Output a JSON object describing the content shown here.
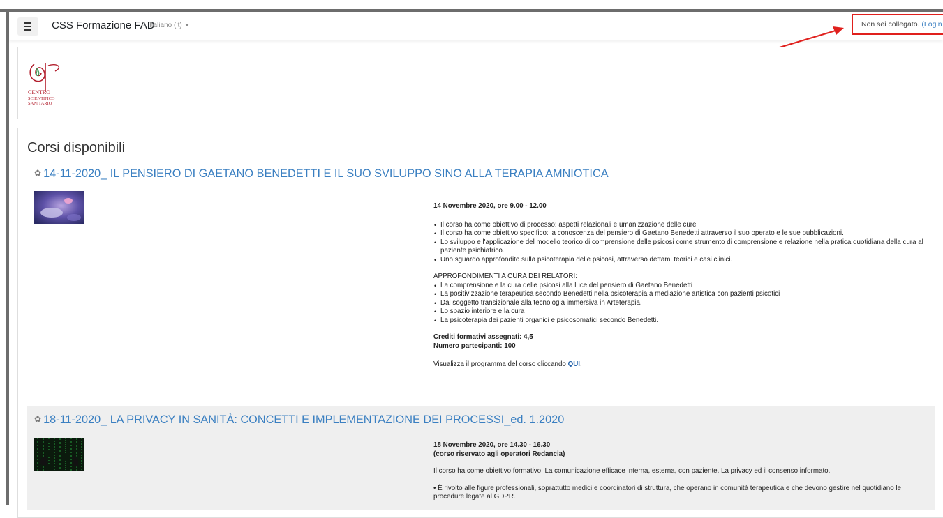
{
  "navbar": {
    "site_name": "CSS Formazione FAD",
    "language": "Italiano (it)",
    "login_text": "Non sei collegato.",
    "login_link": "(Login"
  },
  "logo": {
    "lines": [
      "CENTRO",
      "SCIENTIFICO",
      "SANITARIO"
    ]
  },
  "main": {
    "section_title": "Corsi disponibili",
    "courses": [
      {
        "title": "14-11-2020_ IL PENSIERO DI GAETANO BENEDETTI E IL SUO SVILUPPO SINO ALLA TERAPIA AMNIOTICA",
        "date_line": "14 Novembre 2020, ore 9.00 - 12.00",
        "bullets": [
          "Il corso ha come obiettivo di processo: aspetti relazionali e umanizzazione delle cure",
          "Il corso ha come obiettivo specifico: la conoscenza del pensiero di Gaetano Benedetti attraverso il suo operato e le sue pubblicazioni.",
          "Lo sviluppo e l'applicazione del modello teorico di comprensione delle psicosi come strumento di comprensione e relazione nella pratica quotidiana della cura al paziente psichiatrico.",
          "Uno sguardo approfondito sulla psicoterapia delle psicosi, attraverso dettami teorici e casi clinici."
        ],
        "subheading": "APPROFONDIMENTI A CURA DEI RELATORI:",
        "bullets2": [
          "La comprensione e la cura delle psicosi alla luce del pensiero di Gaetano Benedetti",
          "La positivizzazione terapeutica secondo Benedetti nella psicoterapia a mediazione artistica con pazienti psicotici",
          "Dal soggetto transizionale alla tecnologia immersiva in Arteterapia.",
          "Lo spazio interiore e la cura",
          "La psicoterapia dei pazienti organici e psicosomatici secondo Benedetti."
        ],
        "credits": "Crediti formativi assegnati: 4,5",
        "participants": "Numero partecipanti: 100",
        "program_text": "Visualizza il programma del corso cliccando ",
        "program_link": "QUI",
        "program_suffix": "."
      },
      {
        "title": "18-11-2020_ LA PRIVACY IN SANITÀ: CONCETTI E IMPLEMENTAZIONE DEI PROCESSI_ed. 1.2020",
        "date_line": "18 Novembre 2020, ore 14.30 - 16.30",
        "note": "(corso riservato agli operatori Redancia)",
        "objective": "Il corso ha come obiettivo formativo: La comunicazione efficace interna, esterna, con paziente. La privacy ed il consenso informato.",
        "audience": "• È rivolto alle figure professionali, soprattutto medici e coordinatori di struttura, che operano in comunità terapeutica e che devono gestire nel quotidiano le procedure legate al GDPR."
      }
    ]
  },
  "colors": {
    "link": "#3a7fc1",
    "highlight_red": "#e0201d",
    "frame_gray": "#6d6d6d"
  },
  "icons": {
    "menu": "hamburger-icon",
    "course": "course-cog-icon",
    "dropdown": "caret-down-icon"
  }
}
